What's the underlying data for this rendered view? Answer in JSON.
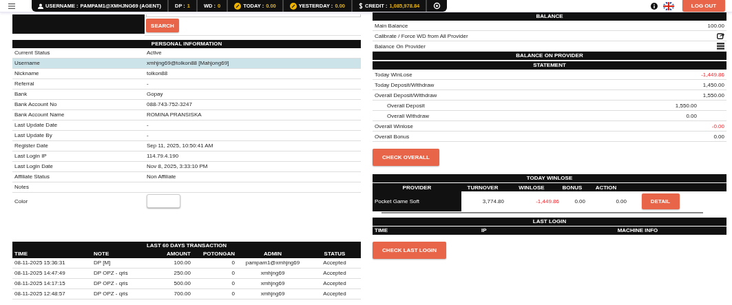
{
  "topbar": {
    "stats": [
      {
        "kind": "user",
        "label": "USERNAME :",
        "value": "PAMPAM1@XMHJNG69 (AGENT)"
      },
      {
        "kind": "plain",
        "label": "DP :",
        "value": "1"
      },
      {
        "kind": "plain",
        "label": "WD :",
        "value": "0"
      },
      {
        "kind": "coin",
        "label": "TODAY :",
        "value": "0.00"
      },
      {
        "kind": "coin",
        "label": "YESTERDAY :",
        "value": "0.00"
      },
      {
        "kind": "dollar",
        "label": "CREDIT :",
        "value": "1,085,978.84"
      }
    ],
    "logout": "LOG OUT"
  },
  "search": {
    "button": "SEARCH"
  },
  "personal": {
    "title": "PERSONAL INFORMATION",
    "rows": [
      {
        "label": "Current Status",
        "value": "Active",
        "selected": false
      },
      {
        "label": "Username",
        "value": "xmhjng69@tolkon88  [Mahjong69]",
        "selected": true
      },
      {
        "label": "Nickname",
        "value": "tolkon88",
        "selected": false
      },
      {
        "label": "Referral",
        "value": "-",
        "selected": false
      },
      {
        "label": "Bank",
        "value": "Gopay",
        "selected": false
      },
      {
        "label": "Bank Account No",
        "value": "088-743-752-3247",
        "selected": false
      },
      {
        "label": "Bank Account Name",
        "value": "ROMINA PRANSISKA",
        "selected": false
      },
      {
        "label": "Last Update Date",
        "value": "-",
        "selected": false
      },
      {
        "label": "Last Update By",
        "value": "-",
        "selected": false
      },
      {
        "label": "Register Date",
        "value": "Sep 11, 2025, 10:50:41 AM",
        "selected": false
      },
      {
        "label": "Last Login IP",
        "value": "114.79.4.190",
        "selected": false
      },
      {
        "label": "Last Login Date",
        "value": "Nov 8, 2025, 3:33:10 PM",
        "selected": false
      },
      {
        "label": "Affiliate Status",
        "value": "Non Affiliate",
        "selected": false
      }
    ],
    "notes_label": "Notes",
    "color_label": "Color"
  },
  "transactions": {
    "title": "LAST 60 DAYS TRANSACTION",
    "columns": [
      "TIME",
      "NOTE",
      "AMOUNT",
      "POTONGAN",
      "ADMIN",
      "STATUS"
    ],
    "rows": [
      [
        "08-11-2025 15:36:31",
        "DP [M]",
        "100.00",
        "0",
        "pampam1@xmhjng69",
        "Accepted"
      ],
      [
        "08-11-2025 14:47:49",
        "DP OPZ - qris",
        "250.00",
        "0",
        "xmhjng69",
        "Accepted"
      ],
      [
        "08-11-2025 14:17:15",
        "DP OPZ - qris",
        "500.00",
        "0",
        "xmhjng69",
        "Accepted"
      ],
      [
        "08-11-2025 12:48:57",
        "DP OPZ - qris",
        "700.00",
        "0",
        "xmhjng69",
        "Accepted"
      ]
    ]
  },
  "balance": {
    "title": "BALANCE",
    "rows": [
      {
        "kind": "value",
        "label": "Main Balance",
        "value": "100.00"
      },
      {
        "kind": "share",
        "label": "Calibrate / Force WD from All Provider"
      },
      {
        "kind": "list",
        "label": "Balance On Provider"
      }
    ],
    "provider_title": "BALANCE ON PROVIDER"
  },
  "statement": {
    "title": "STATEMENT",
    "rows": [
      {
        "label": "Today WinLose",
        "value": "-1,449.86",
        "negative": true
      },
      {
        "label": "Today Deposit/Withdraw",
        "value": "1,450.00",
        "negative": false
      },
      {
        "label": "Overall Deposit/Withdraw",
        "value": "1,550.00",
        "negative": false,
        "children": [
          {
            "label": "Overall Deposit",
            "value": "1,550.00",
            "negative": false
          },
          {
            "label": "Overall Withdraw",
            "value": "0.00",
            "negative": false
          }
        ]
      },
      {
        "label": "Overall Winlose",
        "value": "-0.00",
        "negative": true
      },
      {
        "label": "Overall Bonus",
        "value": "0.00",
        "negative": false
      }
    ],
    "button": "CHECK OVERALL"
  },
  "today_winlose": {
    "title": "TODAY WINLOSE",
    "columns": [
      "PROVIDER",
      "TURNOVER",
      "WINLOSE",
      "BONUS",
      "ACTION"
    ],
    "rows": [
      {
        "provider": "Pocket Game Soft",
        "turnover": "3,774.80",
        "winlose": "-1,449.86",
        "winlose_negative": true,
        "column_4": "0.00",
        "bonus": "0.00",
        "action": "DETAIL"
      }
    ]
  },
  "last_login": {
    "title": "LAST LOGIN",
    "columns": [
      "TIME",
      "IP",
      "MACHINE INFO"
    ],
    "button": "CHECK LAST LOGIN"
  }
}
